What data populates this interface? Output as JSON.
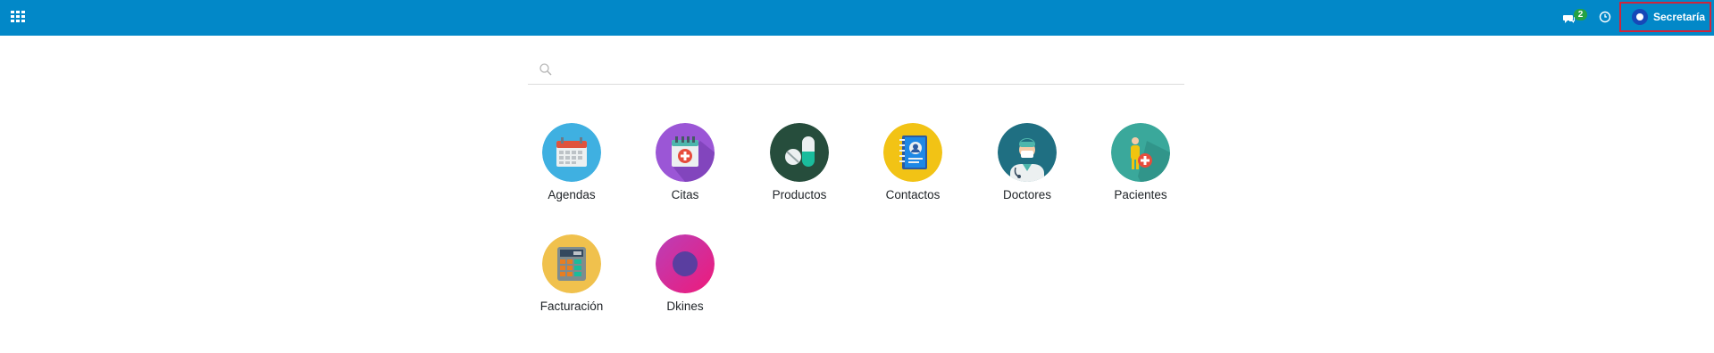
{
  "topbar": {
    "apps_menu_icon": "apps-grid-icon",
    "messages_icon": "chat-icon",
    "messages_count": "2",
    "activities_icon": "clock-icon",
    "user_name": "Secretaría",
    "accent_color": "#0288c8",
    "user_highlight_color": "#d0243a"
  },
  "search": {
    "icon": "search-icon",
    "placeholder": "",
    "value": ""
  },
  "apps": [
    {
      "label": "Agendas",
      "icon": "calendar-icon",
      "color": "#3fb0e1"
    },
    {
      "label": "Citas",
      "icon": "appointment-calendar-icon",
      "color": "#9b56d6"
    },
    {
      "label": "Productos",
      "icon": "pills-icon",
      "color": "#264d3c"
    },
    {
      "label": "Contactos",
      "icon": "address-book-icon",
      "color": "#f2c315"
    },
    {
      "label": "Doctores",
      "icon": "doctor-icon",
      "color": "#1f6f82"
    },
    {
      "label": "Pacientes",
      "icon": "patient-icon",
      "color": "#3aa89b"
    },
    {
      "label": "Facturación",
      "icon": "calculator-icon",
      "color": "#f0c14d"
    },
    {
      "label": "Dkines",
      "icon": "dkines-icon",
      "color": "#e0208c"
    }
  ]
}
